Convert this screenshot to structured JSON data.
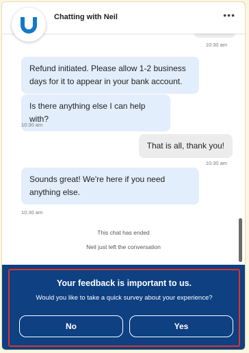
{
  "header": {
    "title": "Chatting with Neil",
    "menu_icon": "more-horizontal-icon",
    "avatar_icon": "brand-u-logo-icon",
    "brand_color": "#1479c8"
  },
  "messages": [
    {
      "from": "agent",
      "text": "Refund initiated. Please allow 1-2 business days for it to appear in your bank account."
    },
    {
      "from": "agent",
      "text": "Is there anything else I can help with?",
      "time": "10:30 am"
    },
    {
      "from": "user",
      "text": "That is all, thank you!",
      "time": "10:30 am"
    },
    {
      "from": "agent",
      "text": "Sounds great! We're here if you need anything else.",
      "time": "10:30 am"
    }
  ],
  "previous_time": "10:30 am",
  "system": {
    "chat_ended": "This chat has ended",
    "left": "Neil just left the conversation"
  },
  "feedback": {
    "title": "Your feedback is important to us.",
    "question": "Would you like to take a quick survey about your experience?",
    "no_label": "No",
    "yes_label": "Yes",
    "background": "#0e4082",
    "highlight_border": "#e0322e"
  },
  "colors": {
    "agent_bubble": "#e2eefb",
    "user_bubble": "#ececec"
  }
}
